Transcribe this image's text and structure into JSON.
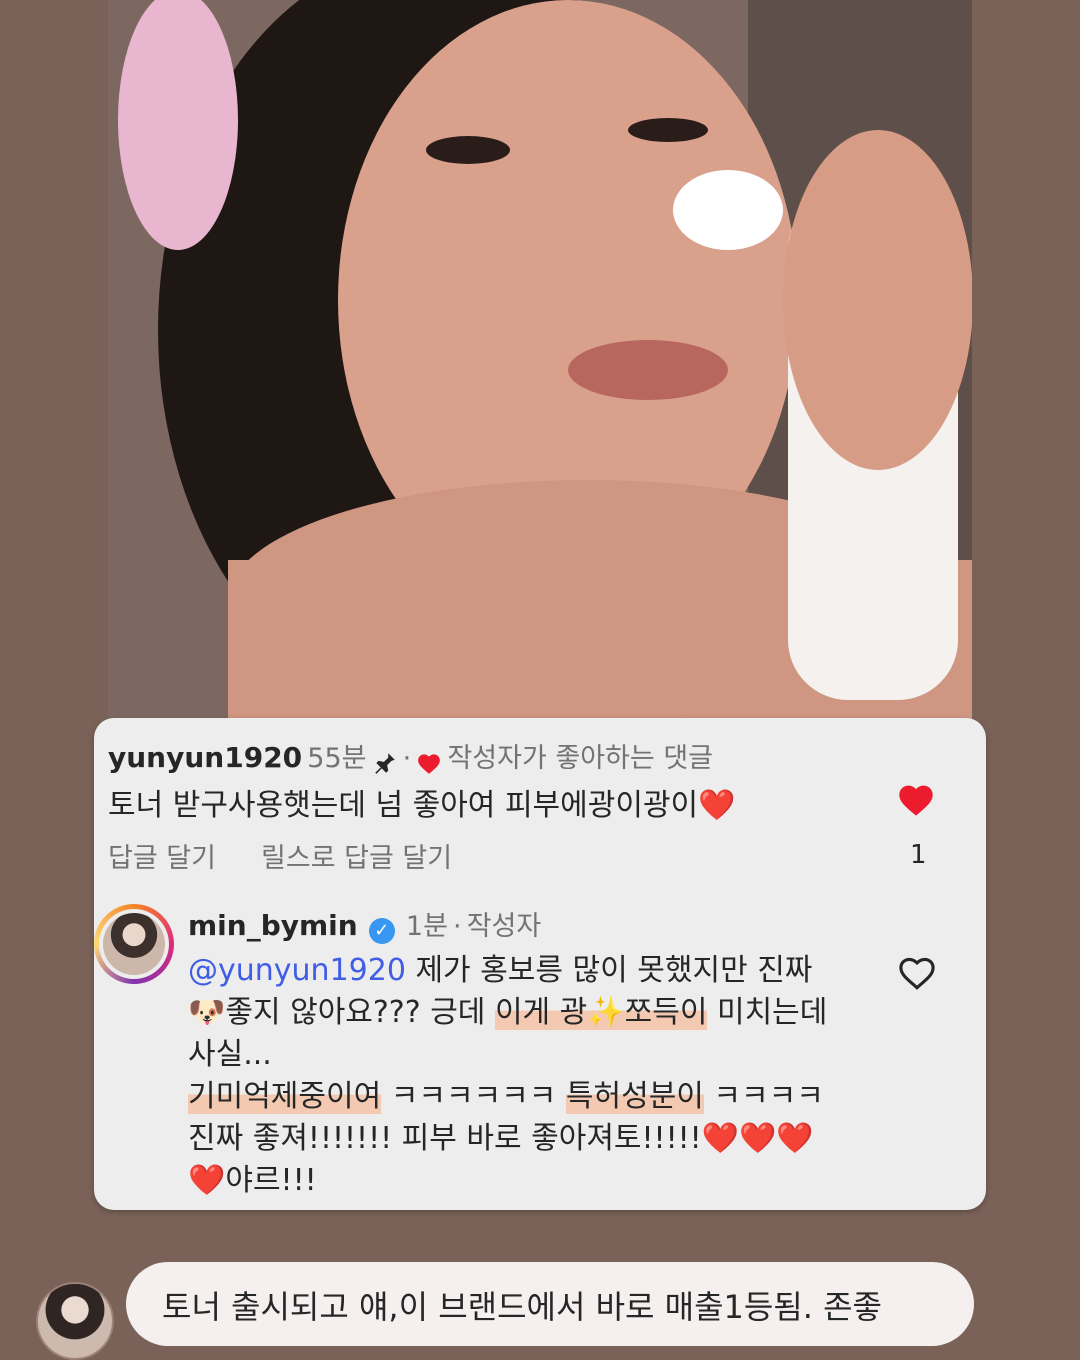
{
  "comment1": {
    "username": "yunyun1920",
    "time": "55분",
    "pin_icon": "pin-icon",
    "liked_badge_icon": "heart-icon",
    "liked_by_creator": "작성자가 좋아하는 댓글",
    "text": "토너 받구사용햇는데 넘 좋아여 피부에광이광이❤️",
    "reply_action": "답글 달기",
    "reels_reply_action": "릴스로 답글 달기",
    "like_count": "1",
    "like_color": "#ed1b2e"
  },
  "comment2": {
    "username": "min_bymin",
    "verified_icon": "verified-badge-icon",
    "time": "1분",
    "role": "작성자",
    "mention": "@yunyun1920",
    "text_part1": " 제가 홍보릉 많이 못했지만 진짜 🐶좋지 않아요??? 긍데 ",
    "text_hl1": "이게 광✨쪼득이",
    "text_part2": " 미치는데 사실...",
    "text_hl2": "기미억제중이여",
    "text_part3": " ㅋㅋㅋㅋㅋㅋ ",
    "text_hl3": "특허성분이",
    "text_part4": " ㅋㅋㅋㅋ 진짜 좋져!!!!!!! 피부 바로 좋아져토!!!!!❤️❤️❤️❤️야르!!!"
  },
  "reply_bubble": {
    "text": "토너 출시되고 얘,이 브랜드에서 바로 매출1등됨. 존좋"
  },
  "colors": {
    "background": "#7a6258",
    "card": "#ededed",
    "highlight": "#f3c9b2",
    "mention": "#405de6"
  }
}
